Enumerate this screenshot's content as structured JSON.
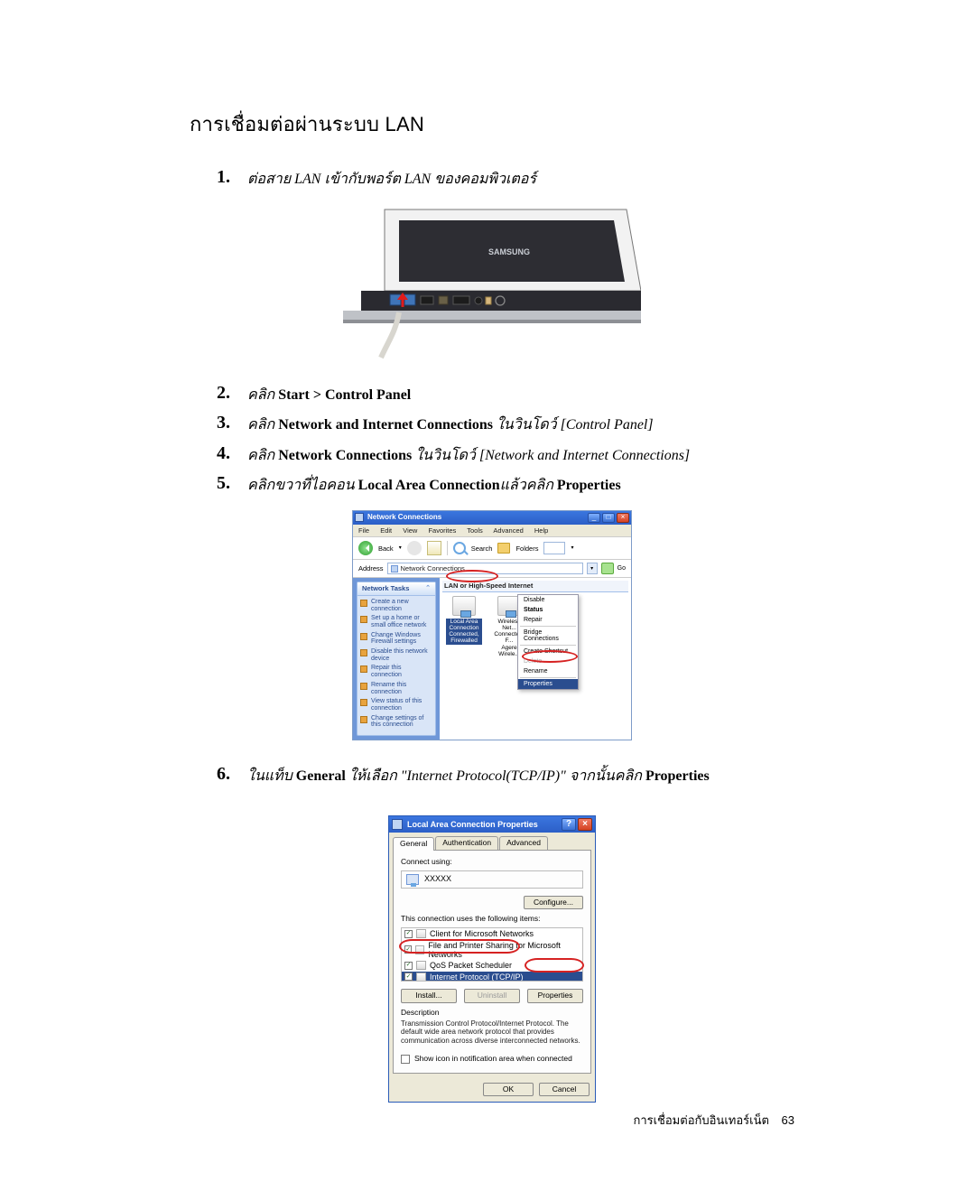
{
  "page": {
    "title": "การเชื่อมต่อผ่านระบบ LAN",
    "footer_section": "การเชื่อมต่อกับอินเทอร์เน็ต",
    "footer_page": "63"
  },
  "steps": {
    "s1": {
      "num": "1.",
      "pre": "ต่อสาย LAN เข้ากับพอร์ต LAN ของคอมพิวเตอร์"
    },
    "s2": {
      "num": "2.",
      "pre": "คลิก ",
      "b": "Start > Control Panel"
    },
    "s3": {
      "num": "3.",
      "pre": "คลิก ",
      "b": "Network and Internet Connections",
      "post": " ในวินโดว์ [Control Panel]"
    },
    "s4": {
      "num": "4.",
      "pre": "คลิก ",
      "b": "Network Connections",
      "post": " ในวินโดว์ [Network and Internet Connections]"
    },
    "s5": {
      "num": "5.",
      "pre": "คลิกขวาที่ไอคอน ",
      "b1": "Local Area Connection",
      "mid": "แล้วคลิก ",
      "b2": "Properties"
    },
    "s6": {
      "num": "6.",
      "pre": "ในแท็บ ",
      "b1": "General",
      "mid": " ให้เลือก \"Internet Protocol(TCP/IP)\" จากนั้นคลิก ",
      "b2": "Properties"
    }
  },
  "laptop": {
    "brand": "SAMSUNG"
  },
  "nc": {
    "title": "Network Connections",
    "menu": {
      "file": "File",
      "edit": "Edit",
      "view": "View",
      "fav": "Favorites",
      "tools": "Tools",
      "adv": "Advanced",
      "help": "Help"
    },
    "toolbar": {
      "back": "Back",
      "search": "Search",
      "folders": "Folders"
    },
    "address": {
      "label": "Address",
      "value": "Network Connections",
      "go": "Go"
    },
    "sidebar": {
      "header": "Network Tasks",
      "items": [
        "Create a new connection",
        "Set up a home or small office network",
        "Change Windows Firewall settings",
        "Disable this network device",
        "Repair this connection",
        "Rename this connection",
        "View status of this connection",
        "Change settings of this connection"
      ]
    },
    "category": "LAN or High-Speed Internet",
    "conn1": {
      "name": "Local Area Connection",
      "state": "Connected, Firewalled"
    },
    "conn2": {
      "name": "Wireless Net...",
      "state": "Connected, F..."
    },
    "conn3": {
      "name": "Agere Wirele..."
    },
    "ctx": {
      "disable": "Disable",
      "status": "Status",
      "repair": "Repair",
      "bridge": "Bridge Connections",
      "shortcut": "Create Shortcut",
      "delete": "Delete",
      "rename": "Rename",
      "properties": "Properties"
    }
  },
  "dlg": {
    "title": "Local Area Connection Properties",
    "tabs": {
      "general": "General",
      "auth": "Authentication",
      "adv": "Advanced"
    },
    "connect_using": "Connect using:",
    "adapter": "XXXXX",
    "configure": "Configure...",
    "uses_items": "This connection uses the following items:",
    "items": [
      "Client for Microsoft Networks",
      "File and Printer Sharing for Microsoft Networks",
      "QoS Packet Scheduler",
      "Internet Protocol (TCP/IP)"
    ],
    "install": "Install...",
    "uninstall": "Uninstall",
    "properties": "Properties",
    "desc_hdr": "Description",
    "desc": "Transmission Control Protocol/Internet Protocol. The default wide area network protocol that provides communication across diverse interconnected networks.",
    "show_icon": "Show icon in notification area when connected",
    "ok": "OK",
    "cancel": "Cancel"
  }
}
